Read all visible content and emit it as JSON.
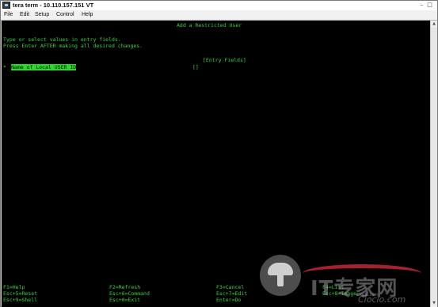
{
  "window": {
    "title": "tera term - 10.110.157.151 VT",
    "minimize_glyph": "–",
    "maximize_glyph": "□"
  },
  "menu": {
    "items": [
      {
        "label": "File"
      },
      {
        "label": "Edit"
      },
      {
        "label": "Setup"
      },
      {
        "label": "Control"
      },
      {
        "label": "Help"
      }
    ]
  },
  "screen": {
    "title": "Add a Restricted User",
    "instructions": [
      "Type or select values in entry fields.",
      "Press Enter AFTER making all desired changes."
    ],
    "entry_fields_header": "[Entry Fields]",
    "fields": [
      {
        "marker": "*",
        "label": "Name of Local USER ID",
        "value": "[]"
      }
    ],
    "function_keys": [
      [
        "F1=Help",
        "F2=Refresh",
        "F3=Cancel",
        "F4=List"
      ],
      [
        "Esc+5=Reset",
        "Esc+6=Command",
        "Esc+7=Edit",
        "Esc+8=Image"
      ],
      [
        "Esc+9=Shell",
        "Esc+0=Exit",
        "Enter=Do",
        ""
      ]
    ]
  },
  "watermark": {
    "brand": "IT专家网",
    "domain": "Ciocio.com",
    "small": "Ciocio.com"
  },
  "colors": {
    "terminal_bg": "#000000",
    "terminal_fg": "#39d33d",
    "highlight_bg": "#2bd92b"
  }
}
